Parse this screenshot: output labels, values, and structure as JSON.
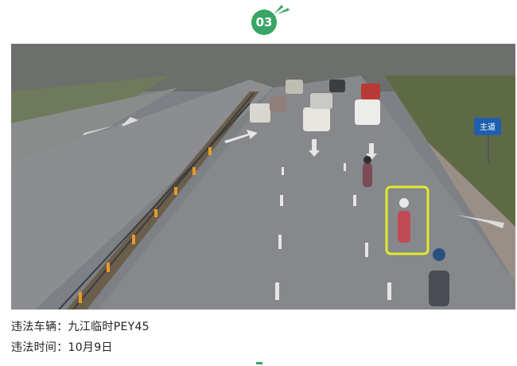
{
  "section": {
    "number": "03"
  },
  "photo": {
    "sign_text": "主道"
  },
  "info": {
    "plate_label": "违法车辆：",
    "plate_value": "九江临时PEY45",
    "time_label": "违法时间：",
    "time_value": "10月9日"
  },
  "colors": {
    "accent": "#3aa565",
    "highlight_box": "#e3ea2b"
  }
}
